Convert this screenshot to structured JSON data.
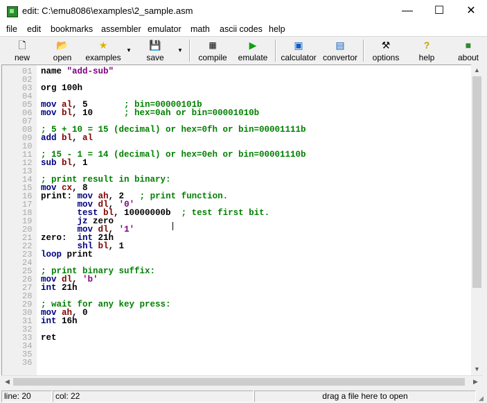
{
  "window": {
    "title": "edit: C:\\emu8086\\examples\\2_sample.asm",
    "minimize": "—",
    "maximize": "☐",
    "close": "✕"
  },
  "menu": [
    "file",
    "edit",
    "bookmarks",
    "assembler",
    "emulator",
    "math",
    "ascii codes",
    "help"
  ],
  "toolbar": {
    "new": "new",
    "open": "open",
    "examples": "examples",
    "save": "save",
    "compile": "compile",
    "emulate": "emulate",
    "calculator": "calculator",
    "convertor": "convertor",
    "options": "options",
    "help": "help",
    "about": "about"
  },
  "editor": {
    "lines": [
      {
        "n": "01",
        "segs": [
          [
            "txt",
            "name "
          ],
          [
            "str",
            "\"add-sub\""
          ]
        ]
      },
      {
        "n": "02",
        "segs": []
      },
      {
        "n": "03",
        "segs": [
          [
            "txt",
            "org 100h"
          ]
        ]
      },
      {
        "n": "04",
        "segs": []
      },
      {
        "n": "05",
        "segs": [
          [
            "kw",
            "mov "
          ],
          [
            "reg",
            "al"
          ],
          [
            "txt",
            ", 5       "
          ],
          [
            "cm",
            "; bin=00000101b"
          ]
        ]
      },
      {
        "n": "06",
        "segs": [
          [
            "kw",
            "mov "
          ],
          [
            "reg",
            "bl"
          ],
          [
            "txt",
            ", 10      "
          ],
          [
            "cm",
            "; hex=0ah or bin=00001010b"
          ]
        ]
      },
      {
        "n": "07",
        "segs": []
      },
      {
        "n": "08",
        "segs": [
          [
            "cm",
            "; 5 + 10 = 15 (decimal) or hex=0fh or bin=00001111b"
          ]
        ]
      },
      {
        "n": "09",
        "segs": [
          [
            "kw",
            "add "
          ],
          [
            "reg",
            "bl"
          ],
          [
            "txt",
            ", "
          ],
          [
            "reg",
            "al"
          ]
        ]
      },
      {
        "n": "10",
        "segs": []
      },
      {
        "n": "11",
        "segs": [
          [
            "cm",
            "; 15 - 1 = 14 (decimal) or hex=0eh or bin=00001110b"
          ]
        ]
      },
      {
        "n": "12",
        "segs": [
          [
            "kw",
            "sub "
          ],
          [
            "reg",
            "bl"
          ],
          [
            "txt",
            ", 1"
          ]
        ]
      },
      {
        "n": "13",
        "segs": []
      },
      {
        "n": "14",
        "segs": [
          [
            "cm",
            "; print result in binary:"
          ]
        ]
      },
      {
        "n": "15",
        "segs": [
          [
            "kw",
            "mov "
          ],
          [
            "reg",
            "cx"
          ],
          [
            "txt",
            ", 8"
          ]
        ]
      },
      {
        "n": "16",
        "segs": [
          [
            "txt",
            "print: "
          ],
          [
            "kw",
            "mov "
          ],
          [
            "reg",
            "ah"
          ],
          [
            "txt",
            ", 2   "
          ],
          [
            "cm",
            "; print function."
          ]
        ]
      },
      {
        "n": "17",
        "segs": [
          [
            "txt",
            "       "
          ],
          [
            "kw",
            "mov "
          ],
          [
            "reg",
            "dl"
          ],
          [
            "txt",
            ", "
          ],
          [
            "str",
            "'0'"
          ]
        ]
      },
      {
        "n": "18",
        "segs": [
          [
            "txt",
            "       "
          ],
          [
            "kw",
            "test "
          ],
          [
            "reg",
            "bl"
          ],
          [
            "txt",
            ", 10000000b  "
          ],
          [
            "cm",
            "; test first bit."
          ]
        ]
      },
      {
        "n": "19",
        "segs": [
          [
            "txt",
            "       "
          ],
          [
            "kw",
            "jz "
          ],
          [
            "txt",
            "zero"
          ]
        ]
      },
      {
        "n": "20",
        "segs": [
          [
            "txt",
            "       "
          ],
          [
            "kw",
            "mov "
          ],
          [
            "reg",
            "dl"
          ],
          [
            "txt",
            ", "
          ],
          [
            "str",
            "'1'"
          ]
        ]
      },
      {
        "n": "21",
        "segs": [
          [
            "txt",
            "zero:  "
          ],
          [
            "kw",
            "int "
          ],
          [
            "txt",
            "21h"
          ]
        ]
      },
      {
        "n": "22",
        "segs": [
          [
            "txt",
            "       "
          ],
          [
            "kw",
            "shl "
          ],
          [
            "reg",
            "bl"
          ],
          [
            "txt",
            ", 1"
          ]
        ]
      },
      {
        "n": "23",
        "segs": [
          [
            "kw",
            "loop "
          ],
          [
            "txt",
            "print"
          ]
        ]
      },
      {
        "n": "24",
        "segs": []
      },
      {
        "n": "25",
        "segs": [
          [
            "cm",
            "; print binary suffix:"
          ]
        ]
      },
      {
        "n": "26",
        "segs": [
          [
            "kw",
            "mov "
          ],
          [
            "reg",
            "dl"
          ],
          [
            "txt",
            ", "
          ],
          [
            "str",
            "'b'"
          ]
        ]
      },
      {
        "n": "27",
        "segs": [
          [
            "kw",
            "int "
          ],
          [
            "txt",
            "21h"
          ]
        ]
      },
      {
        "n": "28",
        "segs": []
      },
      {
        "n": "29",
        "segs": [
          [
            "cm",
            "; wait for any key press:"
          ]
        ]
      },
      {
        "n": "30",
        "segs": [
          [
            "kw",
            "mov "
          ],
          [
            "reg",
            "ah"
          ],
          [
            "txt",
            ", 0"
          ]
        ]
      },
      {
        "n": "31",
        "segs": [
          [
            "kw",
            "int "
          ],
          [
            "txt",
            "16h"
          ]
        ]
      },
      {
        "n": "32",
        "segs": []
      },
      {
        "n": "33",
        "segs": [
          [
            "txt",
            "ret"
          ]
        ]
      },
      {
        "n": "34",
        "segs": []
      },
      {
        "n": "35",
        "segs": []
      },
      {
        "n": "36",
        "segs": []
      }
    ]
  },
  "status": {
    "line": "line: 20",
    "col": "col: 22",
    "hint": "drag a file here to open"
  },
  "colors": {
    "keyword": "#000080",
    "register": "#800000",
    "comment": "#008000",
    "string": "#800080"
  }
}
